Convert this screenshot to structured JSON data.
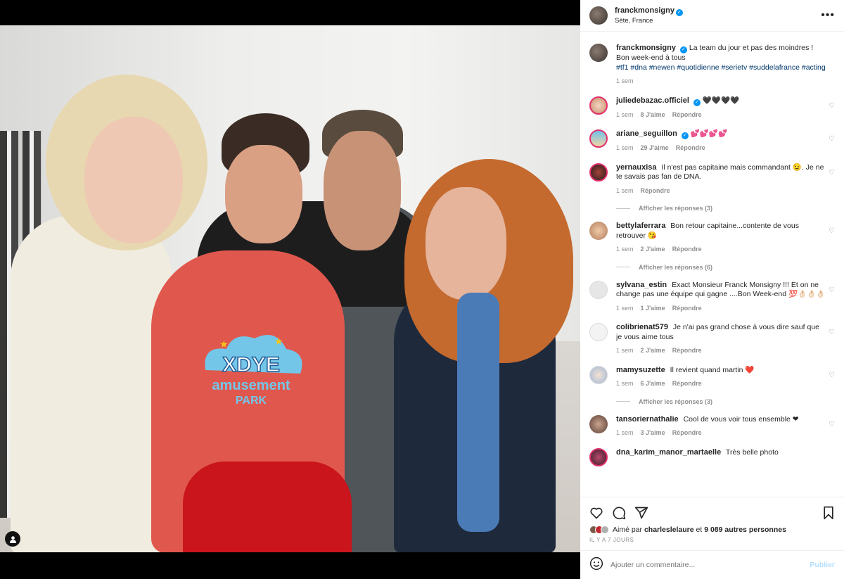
{
  "post": {
    "author": "franckmonsigny",
    "location": "Sète, France",
    "caption_text": "La team du jour et pas des moindres ! Bon week-end à tous",
    "hashtags": "#tf1 #dna #newen #quotidienne #serietv #suddelafrance #acting",
    "time": "1 sem"
  },
  "photo": {
    "sweatshirt_logo": "XDYE",
    "sweatshirt_line2": "amusement",
    "sweatshirt_line3": "PARK"
  },
  "comments": [
    {
      "user": "juliedebazac.officiel",
      "verified": true,
      "text": "🖤🖤🖤🖤",
      "time": "1 sem",
      "likes": "8 J'aime",
      "reply": "Répondre"
    },
    {
      "user": "ariane_seguillon",
      "verified": true,
      "text": "💕💕💕💕",
      "time": "1 sem",
      "likes": "29 J'aime",
      "reply": "Répondre"
    },
    {
      "user": "yernauxisa",
      "verified": false,
      "text": "Il n'est pas capitaine mais commandant 😉. Je ne te savais pas fan de DNA.",
      "time": "1 sem",
      "likes": "",
      "reply": "Répondre",
      "replies": "Afficher les réponses (3)"
    },
    {
      "user": "bettylaferrara",
      "verified": false,
      "text": "Bon retour capitaine...contente de vous retrouver 😘",
      "time": "1 sem",
      "likes": "2 J'aime",
      "reply": "Répondre",
      "replies": "Afficher les réponses (6)"
    },
    {
      "user": "sylvana_estin",
      "verified": false,
      "text": "Exact Monsieur Franck Monsigny !!! Et on ne change pas une équipe qui gagne ....Bon Week-end 💯👌🏻👌🏻👌🏻",
      "time": "1 sem",
      "likes": "1 J'aime",
      "reply": "Répondre"
    },
    {
      "user": "colibrienat579",
      "verified": false,
      "text": "Je n'ai pas grand chose à vous dire sauf que je vous aime tous",
      "time": "1 sem",
      "likes": "2 J'aime",
      "reply": "Répondre"
    },
    {
      "user": "mamysuzette",
      "verified": false,
      "text": "Il revient quand martin ❤️",
      "time": "1 sem",
      "likes": "6 J'aime",
      "reply": "Répondre",
      "replies": "Afficher les réponses (3)"
    },
    {
      "user": "tansoriernathalie",
      "verified": false,
      "text": "Cool de vous voir tous ensemble ❤",
      "time": "1 sem",
      "likes": "3 J'aime",
      "reply": "Répondre"
    },
    {
      "user": "dna_karim_manor_martaelle",
      "verified": false,
      "text": "Très belle photo",
      "time": "",
      "likes": "",
      "reply": ""
    }
  ],
  "likes": {
    "prefix": "Aimé par",
    "user": "charleslelaure",
    "connector": "et",
    "others": "9 089 autres personnes"
  },
  "date": "IL Y A 7 JOURS",
  "add_comment": {
    "placeholder": "Ajouter un commentaire...",
    "publish": "Publier"
  },
  "icons": {
    "like": "heart-icon",
    "comment": "comment-icon",
    "share": "share-icon",
    "save": "bookmark-icon",
    "emoji": "emoji-icon",
    "more": "more-icon"
  },
  "colors": {
    "verified": "#0095f6",
    "hashtag": "#00376b",
    "muted": "#8e8e8e",
    "publish": "#b2dffc"
  }
}
